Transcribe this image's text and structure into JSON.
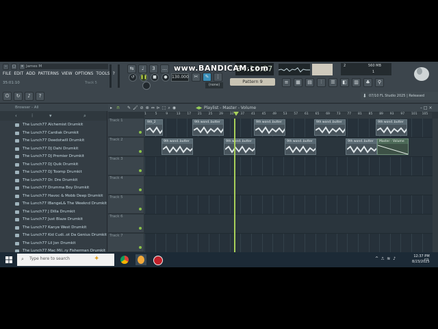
{
  "window": {
    "user": "James M",
    "menu": [
      "FILE",
      "EDIT",
      "ADD",
      "PATTERNS",
      "VIEW",
      "OPTIONS",
      "TOOLS",
      "?"
    ],
    "hint": "35:01:10",
    "track_hint": "Track 5"
  },
  "toolbar": {
    "bpm": "130.000",
    "clock": "34:16:07",
    "pattern": "Pattern 9",
    "none_label": "(none)",
    "cpu_a": "2",
    "cpu_b": "560 MB",
    "cpu_c": "1",
    "watermark": "www.BANDICAM.com",
    "news": "07/10 FL Studio 2025 | Released"
  },
  "browser": {
    "title": "Browser - All",
    "items": [
      "The Lunch77 Alchemist Drumkit",
      "The Lunch77 Cardiak Drumkit",
      "The Lunch77 Deedotwill Drumkit",
      "The Lunch77 DJ Dahi Drumkit",
      "The Lunch77 DJ Premier Drumkit",
      "The Lunch77 DJ Quik Drumkit",
      "The Lunch77 DJ Toomp Drumkit",
      "The Lunch77 Dr. Dre Drumkit",
      "The Lunch77 Drumma Boy Drumkit",
      "The Lunch77 Havoc & Mobb Deep Drumkit",
      "The Lunch77 IBangeL& The Weeknd Drumkit",
      "The Lunch77 J Dilla Drumkit",
      "The Lunch77 Just Blaze Drumkit",
      "The Lunch77 Kanye West Drumkit",
      "The Lunch77 Kid Cudi..ot Da Genius Drumkit",
      "The Lunch77 Lil Jon Drumkit",
      "The Lunch77 Mac Mil..ry Fisherman Drumkit"
    ]
  },
  "playlist": {
    "title": "Playlist - Master - Volume",
    "ruler": [
      "1",
      "5",
      "9",
      "13",
      "17",
      "21",
      "25",
      "29",
      "33",
      "37",
      "41",
      "45",
      "49",
      "53",
      "57",
      "61",
      "65",
      "69",
      "73",
      "77",
      "81",
      "85",
      "89",
      "93",
      "97",
      "101",
      "105"
    ],
    "tracks": [
      "Track 1",
      "Track 2",
      "Track 3",
      "Track 4",
      "Track 5",
      "Track 6",
      "Track 7"
    ],
    "clips_row1": [
      "9th_2",
      "9th wond..butter",
      "9th wond..butter",
      "9th wond..butter",
      "9th wond..butter"
    ],
    "clips_row2": [
      "9th wond..butter",
      "9th wond..butter",
      "9th wond..butter",
      "9th wond..butter"
    ],
    "automation": "Master - Volume"
  },
  "taskbar": {
    "search_placeholder": "Type here to search",
    "time": "12:37 PM",
    "date": "8/23/2025"
  },
  "colors": {
    "accent": "#a8d05a",
    "bg": "#384048"
  }
}
